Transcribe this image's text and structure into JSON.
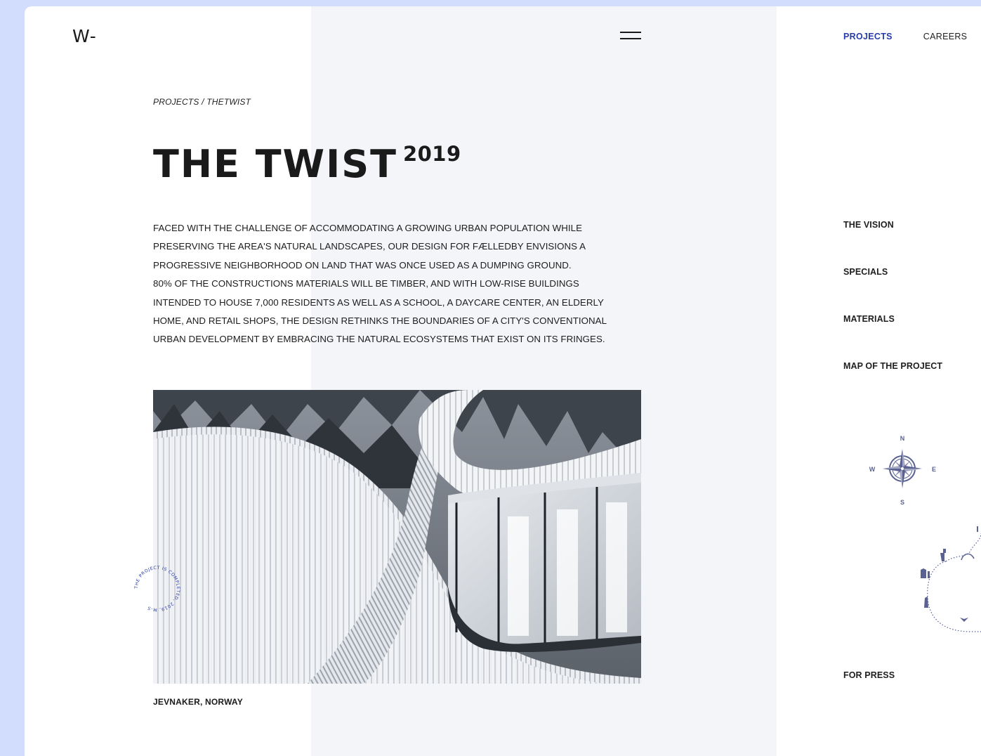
{
  "brand": {
    "logo": "W-"
  },
  "breadcrumb": {
    "root": "PROJECTS",
    "separator": " / ",
    "current": "THETWIST"
  },
  "project": {
    "title": "THE TWIST",
    "year": "2019",
    "description_lines": [
      "FACED WITH THE CHALLENGE OF ACCOMMODATING A GROWING URBAN POPULATION WHILE",
      "PRESERVING THE AREA'S NATURAL LANDSCAPES, OUR DESIGN FOR FÆLLEDBY ENVISIONS A",
      "PROGRESSIVE NEIGHBORHOOD ON LAND THAT WAS ONCE USED AS A DUMPING GROUND.",
      "80% OF THE CONSTRUCTIONS MATERIALS WILL BE TIMBER, AND WITH LOW-RISE BUILDINGS",
      "INTENDED TO HOUSE 7,000 RESIDENTS AS WELL AS A SCHOOL, A DAYCARE CENTER, AN ELDERLY",
      "HOME, AND RETAIL SHOPS, THE DESIGN RETHINKS THE BOUNDARIES OF A CITY'S CONVENTIONAL",
      "URBAN DEVELOPMENT BY EMBRACING THE NATURAL ECOSYSTEMS THAT EXIST ON ITS FRINGES."
    ],
    "location": "JEVNAKER, NORWAY",
    "seal_text": "THE PROJECT IS COMPLETED, 2019, M-S"
  },
  "top_nav": [
    {
      "label": "PROJECTS",
      "active": true
    },
    {
      "label": "CAREERS",
      "active": false
    }
  ],
  "side_nav": {
    "vision": "THE VISION",
    "specials": "SPECIALS",
    "materials": "MATERIALS",
    "map": "MAP OF THE PROJECT",
    "press": "FOR PRESS"
  },
  "compass": {
    "n": "N",
    "s": "S",
    "e": "E",
    "w": "W"
  },
  "colors": {
    "accent": "#2a3ca7",
    "background": "#d2ddfd",
    "panel": "#f4f5f8",
    "icon": "#5a6291"
  },
  "icons": {
    "menu": "hamburger-menu-icon",
    "compass": "compass-rose-icon"
  }
}
